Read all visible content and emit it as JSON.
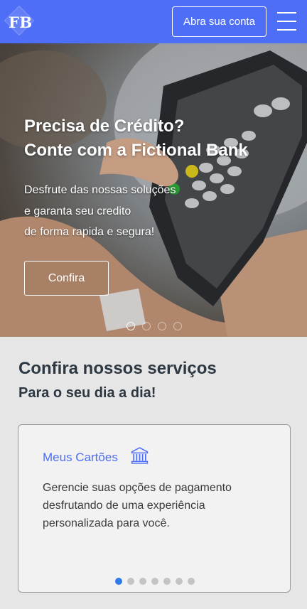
{
  "header": {
    "logo_text": "FB",
    "open_account_label": "Abra sua conta",
    "menu_icon": "hamburger-menu-icon"
  },
  "hero": {
    "title_line1": "Precisa de Crédito?",
    "title_line2": "Conte com a Fictional Bank",
    "text_line1": "Desfrute das nossas soluções",
    "text_line2": "e garanta seu credito",
    "text_line3": "de forma rapida e segura!",
    "button_label": "Confira",
    "slides_count": 4,
    "active_slide": 1
  },
  "services": {
    "title": "Confira nossos serviços",
    "subtitle": "Para o seu dia a dia!",
    "card": {
      "title": "Meus Cartões",
      "icon": "bank-building-icon",
      "text_line1": "Gerencie suas opções de pagamento",
      "text_line2": "desfrutando de uma experiência",
      "text_line3": "personalizada para você.",
      "slides_count": 7,
      "active_slide": 1
    }
  },
  "colors": {
    "brand": "#4f6ef7",
    "heading": "#2e3842",
    "dot_active": "#2f7be8"
  }
}
